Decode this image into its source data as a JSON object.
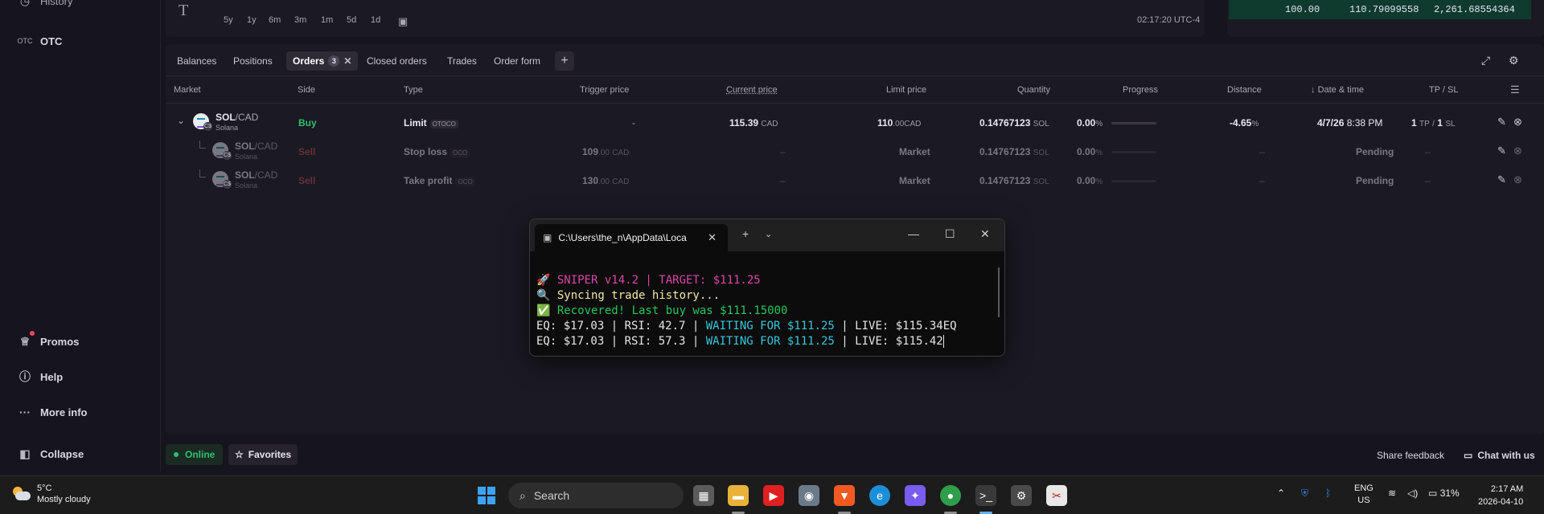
{
  "sidebar": {
    "history_label": "History",
    "otc_prefix": "OTC",
    "otc_label": "OTC",
    "promos_label": "Promos",
    "help_label": "Help",
    "more_label": "More info",
    "collapse_label": "Collapse"
  },
  "chart": {
    "timeframes": [
      "5y",
      "1y",
      "6m",
      "3m",
      "1m",
      "5d",
      "1d"
    ],
    "time": "02:17:20 UTC-4",
    "orderbook_row": {
      "size": "100.00",
      "price": "110.79099558",
      "total": "2,261.68554364"
    }
  },
  "tabs": {
    "balances": "Balances",
    "positions": "Positions",
    "orders": "Orders",
    "orders_count": "3",
    "closed_orders": "Closed orders",
    "trades": "Trades",
    "order_form": "Order form"
  },
  "columns": {
    "market": "Market",
    "side": "Side",
    "type": "Type",
    "trigger_price": "Trigger price",
    "current_price": "Current price",
    "limit_price": "Limit price",
    "quantity": "Quantity",
    "progress": "Progress",
    "distance": "Distance",
    "datetime": "Date & time",
    "tpsl": "TP / SL"
  },
  "orders": [
    {
      "base": "SOL",
      "quote": "/CAD",
      "name": "Solana",
      "side": "Buy",
      "type": "Limit",
      "tag": "OTOCO",
      "trigger": "-",
      "current": "115.39",
      "current_unit": "CAD",
      "limit_int": "110",
      "limit_dec": ".00",
      "limit_unit": "CAD",
      "qty": "0.14767123",
      "qty_unit": "SOL",
      "progress": "0.00",
      "progress_unit": "%",
      "progress_fill": 0,
      "distance": "-4.65",
      "distance_unit": "%",
      "date": "4/7/26",
      "time": "8:38 PM",
      "tp": "1",
      "tp_label": "TP",
      "sl_sep": "/",
      "sl": "1",
      "sl_label": "SL"
    },
    {
      "base": "SOL",
      "quote": "/CAD",
      "name": "Solana",
      "side": "Sell",
      "type": "Stop loss",
      "tag": "OCO",
      "trigger_int": "109",
      "trigger_dec": ".00",
      "trigger_unit": "CAD",
      "current": "–",
      "limit": "Market",
      "qty": "0.14767123",
      "qty_unit": "SOL",
      "progress": "0.00",
      "progress_unit": "%",
      "progress_fill": 0,
      "distance": "–",
      "status": "Pending",
      "tpsl": "–"
    },
    {
      "base": "SOL",
      "quote": "/CAD",
      "name": "Solana",
      "side": "Sell",
      "type": "Take profit",
      "tag": "OCO",
      "trigger_int": "130",
      "trigger_dec": ".00",
      "trigger_unit": "CAD",
      "current": "–",
      "limit": "Market",
      "qty": "0.14767123",
      "qty_unit": "SOL",
      "progress": "0.00",
      "progress_unit": "%",
      "progress_fill": 0,
      "distance": "–",
      "status": "Pending",
      "tpsl": "–"
    }
  ],
  "coin_badge": "C$",
  "terminal": {
    "tab_title": "C:\\Users\\the_n\\AppData\\Loca",
    "line1": "🚀 SNIPER v14.2 | TARGET: $111.25",
    "line2": "🔍 Syncing trade history...",
    "line3": "✅ Recovered! Last buy was $111.15000",
    "line4_a": "EQ: $17.03 | RSI: 42.7 | ",
    "line4_b": "WAITING FOR $111.25",
    "line4_c": " | LIVE: $115.34EQ",
    "line5_a": "EQ: $17.03 | RSI: 57.3 | ",
    "line5_b": "WAITING FOR $111.25",
    "line5_c": " | LIVE: $115.42"
  },
  "status": {
    "online": "Online",
    "favorites": "Favorites",
    "share_feedback": "Share feedback",
    "chat": "Chat with us"
  },
  "taskbar": {
    "temp": "5°C",
    "weather": "Mostly cloudy",
    "search_placeholder": "Search",
    "lang": "ENG",
    "region": "US",
    "battery": "31%",
    "time": "2:17 AM",
    "date": "2026-04-10"
  },
  "colors": {
    "buy": "#2fbf71",
    "sell": "#c44a55",
    "accent_pink": "#d946a8",
    "accent_cyan": "#37c6d9"
  }
}
